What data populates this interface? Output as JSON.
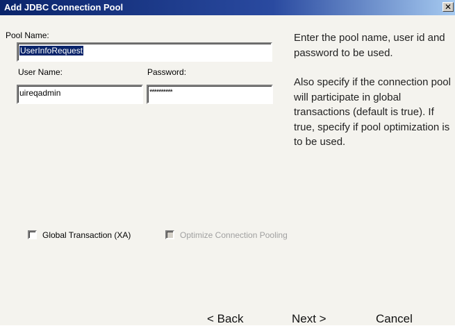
{
  "window": {
    "title": "Add JDBC Connection Pool",
    "close_glyph": "✕"
  },
  "form": {
    "pool_name_label": "Pool Name:",
    "pool_name_value": "UserInfoRequest",
    "user_name_label": "User Name:",
    "user_name_value": "uireqadmin",
    "password_label": "Password:",
    "password_value": "**********"
  },
  "help": {
    "paragraph1": "Enter the pool name, user id and password to be used.",
    "paragraph2": "Also specify if the connection pool will participate in global transactions (default is true).  If true, specify if pool optimization is to be used."
  },
  "options": {
    "global_transaction_label": "Global Transaction (XA)",
    "global_transaction_checked": false,
    "optimize_pooling_label": "Optimize Connection Pooling",
    "optimize_pooling_enabled": false
  },
  "buttons": {
    "back": "< Back",
    "next": "Next >",
    "cancel": "Cancel"
  }
}
